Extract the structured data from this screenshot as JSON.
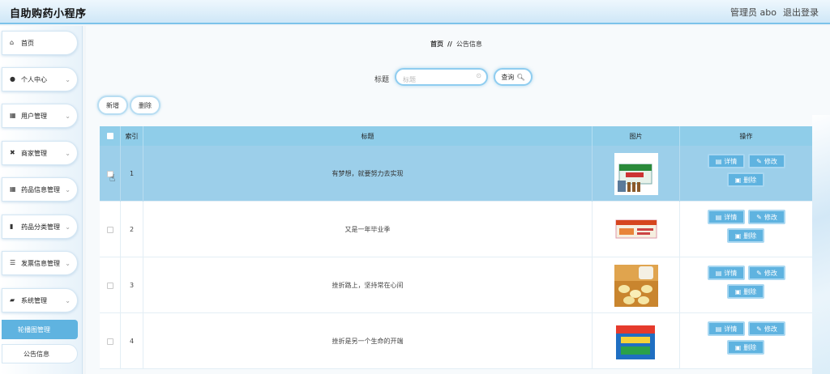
{
  "header": {
    "title": "自助购药小程序",
    "user": "管理员 abo",
    "logout": "退出登录"
  },
  "sidebar": {
    "items": [
      {
        "label": "首页",
        "icon": "home-icon",
        "expandable": false
      },
      {
        "label": "个人中心",
        "icon": "user-icon",
        "expandable": true
      },
      {
        "label": "用户管理",
        "icon": "grid-icon",
        "expandable": true
      },
      {
        "label": "商家管理",
        "icon": "store-icon",
        "expandable": true
      },
      {
        "label": "药品信息管理",
        "icon": "grid-icon",
        "expandable": true
      },
      {
        "label": "药品分类管理",
        "icon": "trash-icon",
        "expandable": true
      },
      {
        "label": "发票信息管理",
        "icon": "list-icon",
        "expandable": true
      },
      {
        "label": "系统管理",
        "icon": "lock-icon",
        "expandable": true
      }
    ],
    "sub_items": [
      {
        "label": "轮播图管理",
        "active": true
      },
      {
        "label": "公告信息",
        "active": false
      }
    ]
  },
  "breadcrumb": {
    "home": "首页",
    "separator": "//",
    "current": "公告信息"
  },
  "search": {
    "label": "标题",
    "placeholder": "标题",
    "button": "查询"
  },
  "actions": {
    "add": "新增",
    "delete": "删除"
  },
  "table": {
    "headers": {
      "index": "索引",
      "title": "标题",
      "image": "图片",
      "actions": "操作"
    },
    "row_buttons": {
      "detail": "详情",
      "edit": "修改",
      "delete": "删除"
    },
    "rows": [
      {
        "index": "1",
        "title": "有梦想，就要努力去实现",
        "image": "medicine-box-green"
      },
      {
        "index": "2",
        "title": "又是一年毕业季",
        "image": "medicine-box-orange"
      },
      {
        "index": "3",
        "title": "挫折路上，坚持常在心间",
        "image": "yellow-pills"
      },
      {
        "index": "4",
        "title": "挫折是另一个生命的开端",
        "image": "medicine-box-blue"
      }
    ]
  },
  "colors": {
    "accent": "#5fb3e0",
    "table_header": "#8fcde9",
    "selected_row": "#9ccfea"
  }
}
